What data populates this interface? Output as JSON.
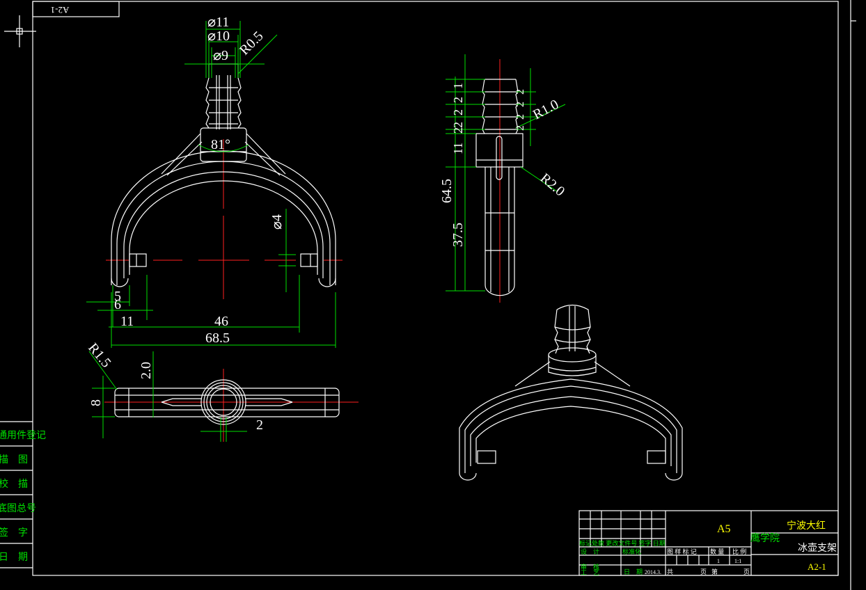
{
  "drawing_no_rotated": "A2-1",
  "dims": {
    "d11": "⌀11",
    "d10": "⌀10",
    "d9": "⌀9",
    "r05": "R0.5",
    "a81": "81°",
    "d4": "⌀4",
    "n5": "5",
    "n6": "6",
    "n11": "11",
    "n46": "46",
    "n685": "68.5",
    "r15": "R1.5",
    "n20": "2.0",
    "n8": "8",
    "n2": "2",
    "s1": "1",
    "s2a": "2",
    "s2b": "2",
    "s2c": "2",
    "s2d": "2",
    "s11": "11",
    "s645": "64.5",
    "s375": "37.5",
    "r2a": "2",
    "r2b": "2",
    "r2c": "2",
    "r2d": "2",
    "r10": "R1.0",
    "r20": "R2.0"
  },
  "left_table": [
    "通用件登记",
    "描　图",
    "校　描",
    "底图总号",
    "签　字",
    "日　期"
  ],
  "title_block": {
    "paper": "A5",
    "company1": "宁波大红",
    "company2": "鹰学院",
    "part_name": "冰壶支架",
    "drawing_no": "A2-1",
    "sign_row": "标记处数 更改文件号 签字 日期",
    "design": "设　计",
    "standard": "标准化",
    "review": "审　核",
    "process": "工　艺",
    "date_label": "日　期",
    "date_value": "2014.3.",
    "stage_headers": "图 样 标 记",
    "qty_header": "数 量",
    "scale_header": "比 例",
    "qty_value": "1",
    "scale_value": "1:1",
    "total": "共",
    "page": "页",
    "sheet": "第",
    "page2": "页"
  }
}
